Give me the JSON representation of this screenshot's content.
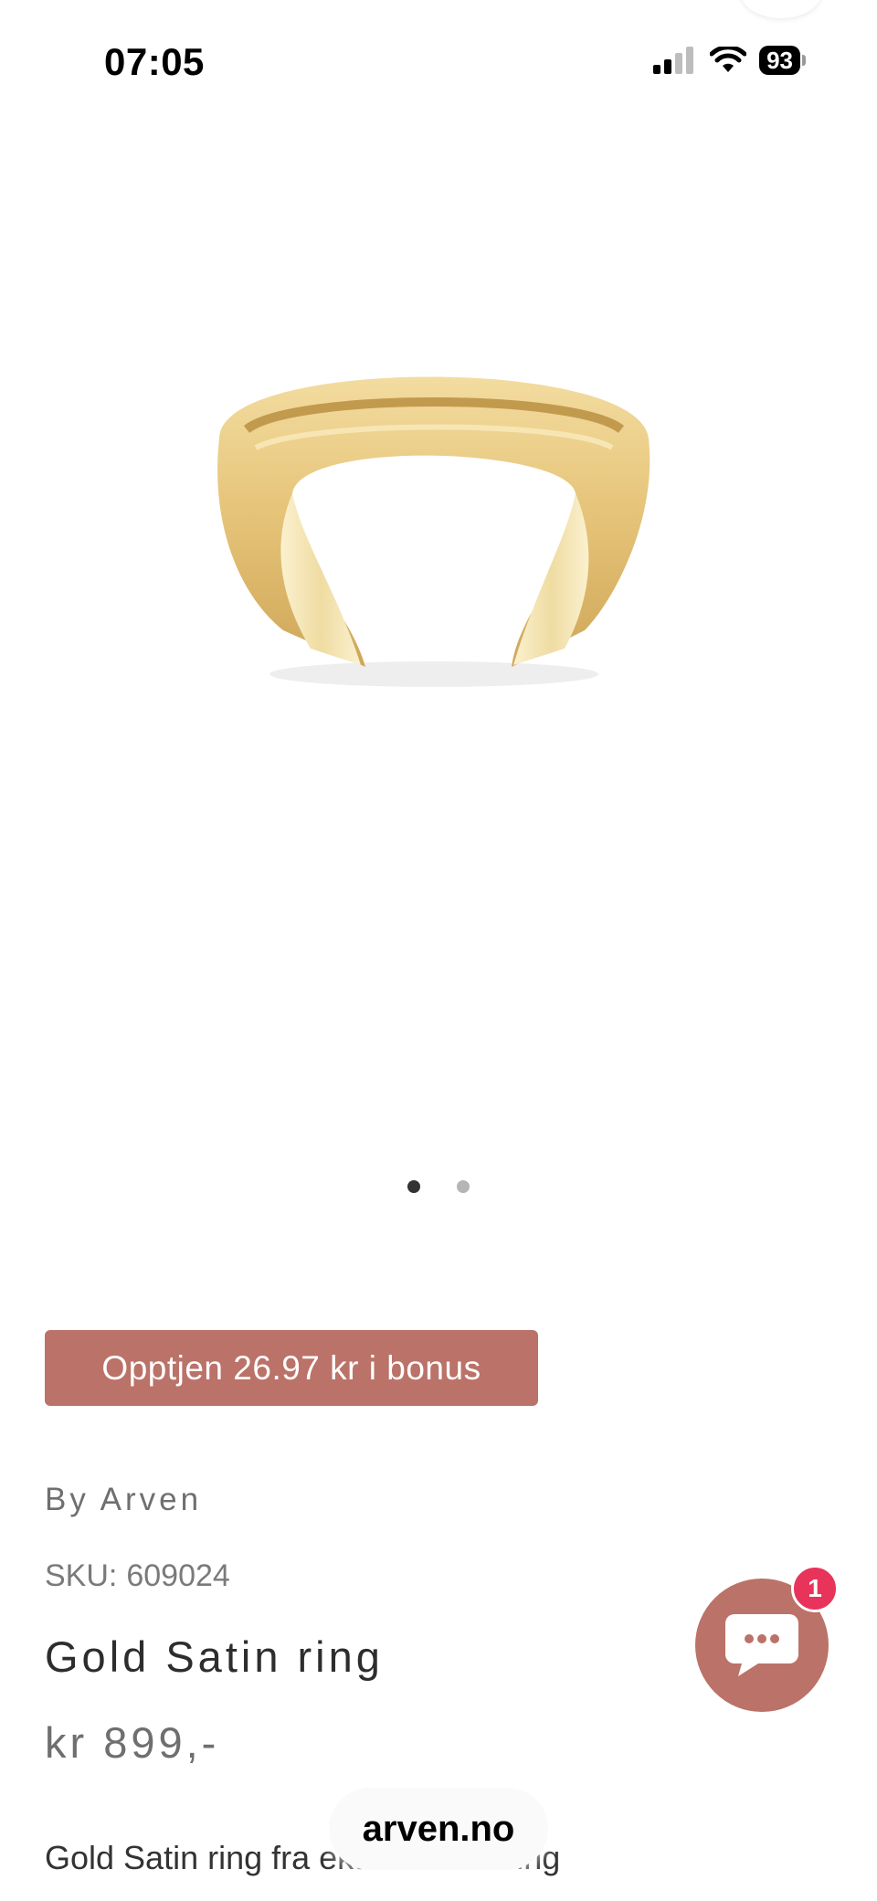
{
  "status_bar": {
    "time": "07:05",
    "battery": "93",
    "icons": [
      "signal-icon",
      "wifi-icon",
      "battery-icon"
    ]
  },
  "gallery": {
    "image": "gold-ring",
    "dots_total": 2,
    "active_index": 0
  },
  "bonus": {
    "label": "Opptjen 26.97 kr i bonus"
  },
  "product": {
    "vendor": "By Arven",
    "sku_label": "SKU:",
    "sku": "609024",
    "title": "Gold Satin ring",
    "price": "kr 899,-",
    "description": "Gold Satin ring fra ekte 925 sterling"
  },
  "chat": {
    "badge_count": "1"
  },
  "browser": {
    "url": "arven.no"
  },
  "colors": {
    "accent": "#bb7268",
    "badge": "#e8345a"
  }
}
